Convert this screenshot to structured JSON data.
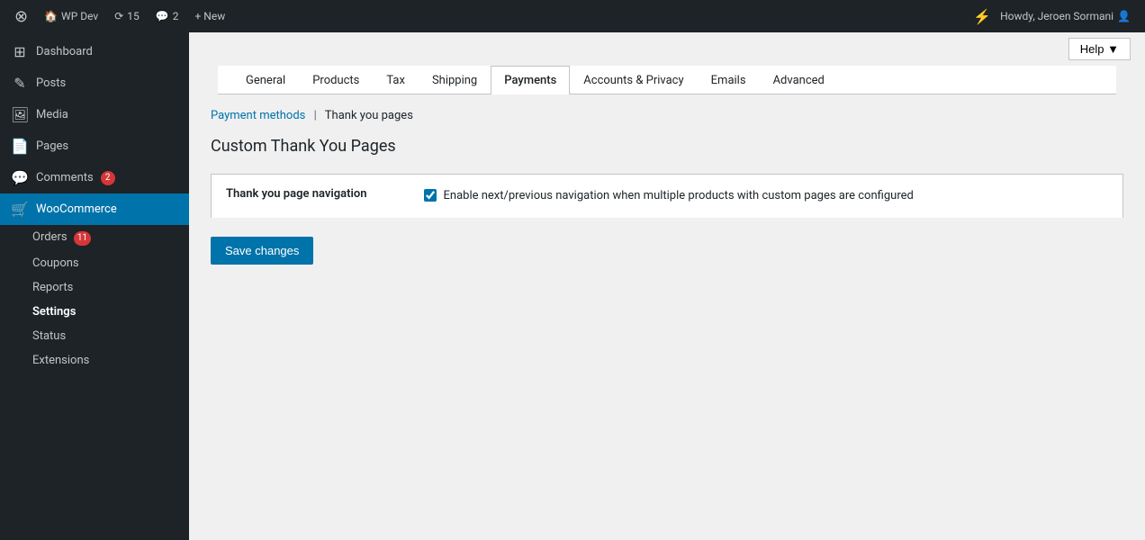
{
  "adminBar": {
    "logo": "⊞",
    "site": "WP Dev",
    "updates_icon": "⟳",
    "updates_count": "15",
    "comments_icon": "💬",
    "comments_count": "2",
    "new_label": "+ New",
    "lightning_icon": "⚡",
    "user_greeting": "Howdy, Jeroen Sormani",
    "user_icon": "👤",
    "help_label": "Help ▼"
  },
  "sidebar": {
    "items": [
      {
        "id": "dashboard",
        "icon": "⊞",
        "label": "Dashboard"
      },
      {
        "id": "posts",
        "icon": "✎",
        "label": "Posts"
      },
      {
        "id": "media",
        "icon": "🖼",
        "label": "Media"
      },
      {
        "id": "pages",
        "icon": "📄",
        "label": "Pages"
      },
      {
        "id": "comments",
        "icon": "💬",
        "label": "Comments",
        "badge": "2"
      },
      {
        "id": "woocommerce",
        "icon": "🛒",
        "label": "WooCommerce",
        "active": true
      }
    ],
    "subitems": [
      {
        "id": "orders",
        "label": "Orders",
        "badge": "11"
      },
      {
        "id": "coupons",
        "label": "Coupons"
      },
      {
        "id": "reports",
        "label": "Reports"
      },
      {
        "id": "settings",
        "label": "Settings",
        "active": true
      },
      {
        "id": "status",
        "label": "Status"
      },
      {
        "id": "extensions",
        "label": "Extensions"
      }
    ]
  },
  "tabs": [
    {
      "id": "general",
      "label": "General"
    },
    {
      "id": "products",
      "label": "Products"
    },
    {
      "id": "tax",
      "label": "Tax"
    },
    {
      "id": "shipping",
      "label": "Shipping"
    },
    {
      "id": "payments",
      "label": "Payments",
      "active": true
    },
    {
      "id": "accounts-privacy",
      "label": "Accounts & Privacy"
    },
    {
      "id": "emails",
      "label": "Emails"
    },
    {
      "id": "advanced",
      "label": "Advanced"
    }
  ],
  "breadcrumb": {
    "parent_label": "Payment methods",
    "separator": "|",
    "current": "Thank you pages"
  },
  "page": {
    "title": "Custom Thank You Pages",
    "setting_label": "Thank you page navigation",
    "checkbox_label": "Enable next/previous navigation when multiple products with custom pages are configured",
    "checkbox_checked": true,
    "save_button": "Save changes"
  }
}
